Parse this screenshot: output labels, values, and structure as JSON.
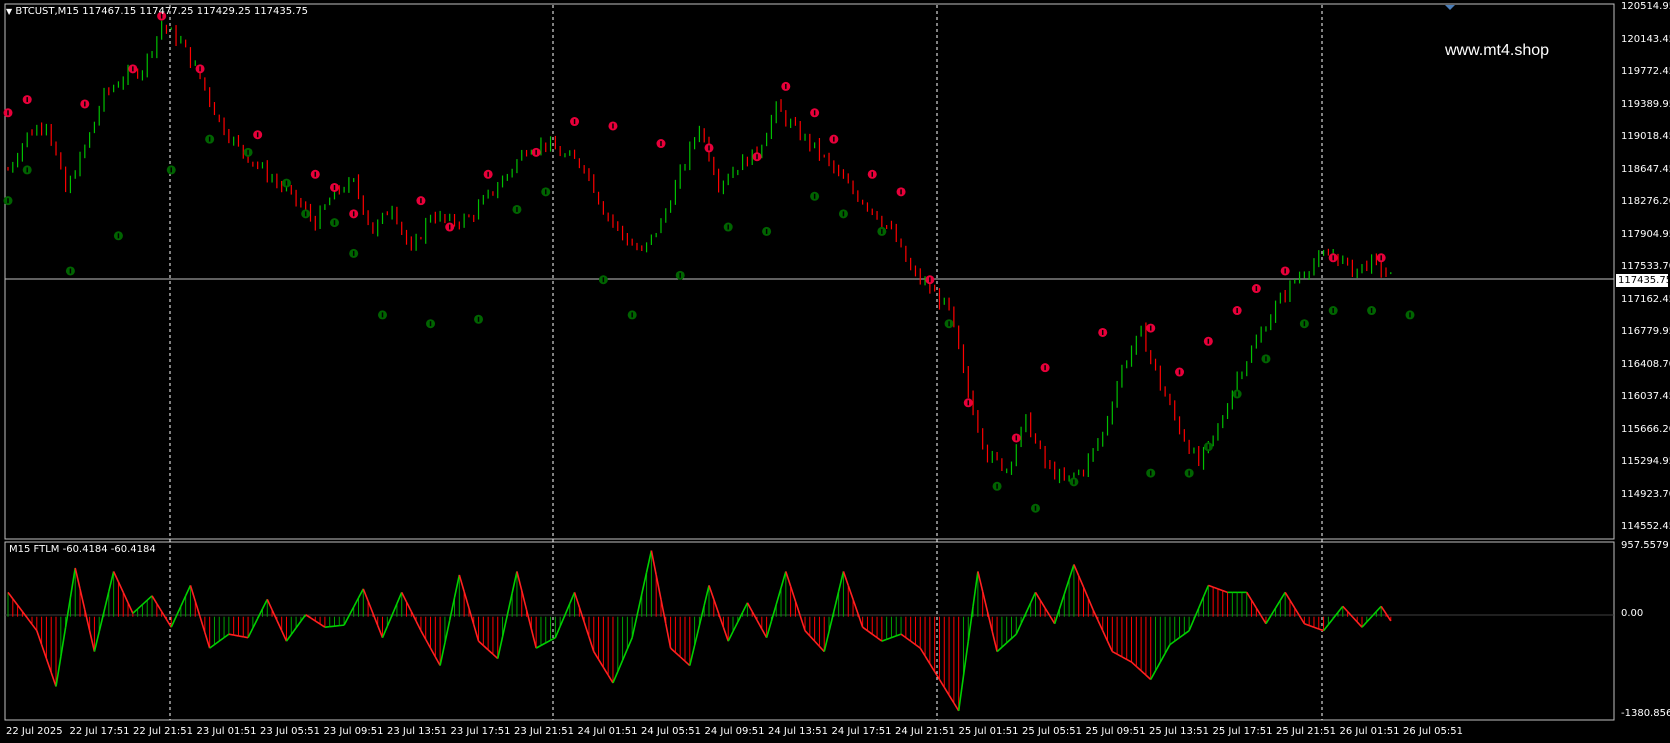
{
  "main_chart": {
    "menu_icon": "triangle-down-icon",
    "symbol_info": "BTCUST,M15  117467.15 117477.25 117429.25 117435.75",
    "watermark": "www.mt4.shop",
    "current_price": "117435.75",
    "price_scale": [
      "120514.95",
      "120143.45",
      "119772.45",
      "119389.95",
      "119018.45",
      "118647.45",
      "118276.20",
      "117904.95",
      "117533.70",
      "117162.45",
      "116779.95",
      "116408.70",
      "116037.45",
      "115666.20",
      "115294.95",
      "114923.70",
      "114552.45"
    ],
    "colors": {
      "bull": "#00c000",
      "bear": "#ff0000",
      "up_arrow": "#006400",
      "down_arrow": "#e8003a",
      "grid": "#ffffff"
    }
  },
  "indicator": {
    "title": "M15 FTLM -60.4184 -60.4184",
    "scale": [
      "957.5579",
      "0.00",
      "-1380.8564"
    ]
  },
  "time_axis": [
    "22 Jul 2025",
    "22 Jul 17:51",
    "22 Jul 21:51",
    "23 Jul 01:51",
    "23 Jul 05:51",
    "23 Jul 09:51",
    "23 Jul 13:51",
    "23 Jul 17:51",
    "23 Jul 21:51",
    "24 Jul 01:51",
    "24 Jul 05:51",
    "24 Jul 09:51",
    "24 Jul 13:51",
    "24 Jul 17:51",
    "24 Jul 21:51",
    "25 Jul 01:51",
    "25 Jul 05:51",
    "25 Jul 09:51",
    "25 Jul 13:51",
    "25 Jul 17:51",
    "25 Jul 21:51",
    "26 Jul 01:51",
    "26 Jul 05:51"
  ],
  "chart_data": {
    "type": "candlestick",
    "interval": "M15",
    "ylim": [
      114552.45,
      120514.95
    ],
    "close_path": [
      [
        0,
        118650
      ],
      [
        4,
        119050
      ],
      [
        8,
        119200
      ],
      [
        12,
        118400
      ],
      [
        16,
        118900
      ],
      [
        20,
        119500
      ],
      [
        24,
        119700
      ],
      [
        28,
        119800
      ],
      [
        32,
        120300
      ],
      [
        36,
        120100
      ],
      [
        40,
        119700
      ],
      [
        44,
        119200
      ],
      [
        48,
        118900
      ],
      [
        52,
        118700
      ],
      [
        56,
        118500
      ],
      [
        60,
        118300
      ],
      [
        64,
        118050
      ],
      [
        68,
        118400
      ],
      [
        72,
        118500
      ],
      [
        76,
        117950
      ],
      [
        80,
        118250
      ],
      [
        84,
        117700
      ],
      [
        88,
        118150
      ],
      [
        92,
        118050
      ],
      [
        96,
        118100
      ],
      [
        100,
        118350
      ],
      [
        104,
        118600
      ],
      [
        108,
        118900
      ],
      [
        112,
        118950
      ],
      [
        116,
        118800
      ],
      [
        120,
        118700
      ],
      [
        124,
        118200
      ],
      [
        128,
        117900
      ],
      [
        132,
        117700
      ],
      [
        136,
        118050
      ],
      [
        140,
        118600
      ],
      [
        144,
        119150
      ],
      [
        148,
        118500
      ],
      [
        152,
        118700
      ],
      [
        156,
        118850
      ],
      [
        160,
        119350
      ],
      [
        164,
        119100
      ],
      [
        168,
        118900
      ],
      [
        172,
        118650
      ],
      [
        176,
        118400
      ],
      [
        180,
        118200
      ],
      [
        184,
        117950
      ],
      [
        188,
        117500
      ],
      [
        192,
        117300
      ],
      [
        196,
        117050
      ],
      [
        200,
        116100
      ],
      [
        204,
        115400
      ],
      [
        208,
        115250
      ],
      [
        212,
        115800
      ],
      [
        216,
        115300
      ],
      [
        220,
        115100
      ],
      [
        224,
        115250
      ],
      [
        228,
        115650
      ],
      [
        232,
        116400
      ],
      [
        236,
        116800
      ],
      [
        240,
        116200
      ],
      [
        244,
        115700
      ],
      [
        248,
        115300
      ],
      [
        252,
        115700
      ],
      [
        256,
        116300
      ],
      [
        260,
        116700
      ],
      [
        264,
        117100
      ],
      [
        268,
        117400
      ],
      [
        272,
        117600
      ],
      [
        276,
        117700
      ],
      [
        280,
        117500
      ],
      [
        284,
        117600
      ],
      [
        288,
        117435
      ]
    ],
    "up_arrows": [
      [
        0,
        118300
      ],
      [
        4,
        118650
      ],
      [
        13,
        117500
      ],
      [
        23,
        117900
      ],
      [
        34,
        118650
      ],
      [
        42,
        119000
      ],
      [
        50,
        118850
      ],
      [
        58,
        118500
      ],
      [
        62,
        118150
      ],
      [
        68,
        118050
      ],
      [
        72,
        117700
      ],
      [
        78,
        117000
      ],
      [
        88,
        116900
      ],
      [
        98,
        116950
      ],
      [
        106,
        118200
      ],
      [
        112,
        118400
      ],
      [
        124,
        117400
      ],
      [
        130,
        117000
      ],
      [
        140,
        117450
      ],
      [
        150,
        118000
      ],
      [
        158,
        117950
      ],
      [
        168,
        118350
      ],
      [
        174,
        118150
      ],
      [
        182,
        117950
      ],
      [
        196,
        116900
      ],
      [
        206,
        115050
      ],
      [
        214,
        114800
      ],
      [
        222,
        115100
      ],
      [
        238,
        115200
      ],
      [
        246,
        115200
      ],
      [
        250,
        115500
      ],
      [
        256,
        116100
      ],
      [
        262,
        116500
      ],
      [
        270,
        116900
      ],
      [
        276,
        117050
      ],
      [
        284,
        117050
      ],
      [
        292,
        117000
      ]
    ],
    "down_arrows": [
      [
        0,
        119300
      ],
      [
        4,
        119450
      ],
      [
        16,
        119400
      ],
      [
        26,
        119800
      ],
      [
        32,
        120400
      ],
      [
        40,
        119800
      ],
      [
        52,
        119050
      ],
      [
        64,
        118600
      ],
      [
        68,
        118450
      ],
      [
        72,
        118150
      ],
      [
        86,
        118300
      ],
      [
        92,
        118000
      ],
      [
        100,
        118600
      ],
      [
        110,
        118850
      ],
      [
        118,
        119200
      ],
      [
        126,
        119150
      ],
      [
        136,
        118950
      ],
      [
        146,
        118900
      ],
      [
        156,
        118800
      ],
      [
        162,
        119600
      ],
      [
        168,
        119300
      ],
      [
        172,
        119000
      ],
      [
        180,
        118600
      ],
      [
        186,
        118400
      ],
      [
        192,
        117400
      ],
      [
        200,
        116000
      ],
      [
        210,
        115600
      ],
      [
        216,
        116400
      ],
      [
        228,
        116800
      ],
      [
        238,
        116850
      ],
      [
        244,
        116350
      ],
      [
        250,
        116700
      ],
      [
        256,
        117050
      ],
      [
        260,
        117300
      ],
      [
        266,
        117500
      ],
      [
        276,
        117650
      ],
      [
        286,
        117650
      ]
    ],
    "indicator_series": {
      "name": "FTLM",
      "ylim": [
        -1380.8564,
        957.5579
      ],
      "points": [
        [
          0,
          350
        ],
        [
          6,
          -200
        ],
        [
          10,
          -1000
        ],
        [
          14,
          700
        ],
        [
          18,
          -500
        ],
        [
          22,
          650
        ],
        [
          26,
          50
        ],
        [
          30,
          300
        ],
        [
          34,
          -150
        ],
        [
          38,
          450
        ],
        [
          42,
          -450
        ],
        [
          46,
          -250
        ],
        [
          50,
          -300
        ],
        [
          54,
          250
        ],
        [
          58,
          -350
        ],
        [
          62,
          30
        ],
        [
          66,
          -150
        ],
        [
          70,
          -120
        ],
        [
          74,
          400
        ],
        [
          78,
          -300
        ],
        [
          82,
          350
        ],
        [
          86,
          -200
        ],
        [
          90,
          -700
        ],
        [
          94,
          600
        ],
        [
          98,
          -350
        ],
        [
          102,
          -600
        ],
        [
          106,
          650
        ],
        [
          110,
          -450
        ],
        [
          114,
          -300
        ],
        [
          118,
          350
        ],
        [
          122,
          -500
        ],
        [
          126,
          -950
        ],
        [
          130,
          -300
        ],
        [
          134,
          950
        ],
        [
          138,
          -450
        ],
        [
          142,
          -700
        ],
        [
          146,
          450
        ],
        [
          150,
          -350
        ],
        [
          154,
          200
        ],
        [
          158,
          -300
        ],
        [
          162,
          650
        ],
        [
          166,
          -200
        ],
        [
          170,
          -500
        ],
        [
          174,
          650
        ],
        [
          178,
          -150
        ],
        [
          182,
          -350
        ],
        [
          186,
          -250
        ],
        [
          190,
          -450
        ],
        [
          194,
          -900
        ],
        [
          198,
          -1350
        ],
        [
          202,
          650
        ],
        [
          206,
          -500
        ],
        [
          210,
          -250
        ],
        [
          214,
          350
        ],
        [
          218,
          -100
        ],
        [
          222,
          750
        ],
        [
          226,
          100
        ],
        [
          230,
          -500
        ],
        [
          234,
          -650
        ],
        [
          238,
          -900
        ],
        [
          242,
          -400
        ],
        [
          246,
          -200
        ],
        [
          250,
          450
        ],
        [
          254,
          350
        ],
        [
          258,
          350
        ],
        [
          262,
          -100
        ],
        [
          266,
          350
        ],
        [
          270,
          -100
        ],
        [
          274,
          -200
        ],
        [
          278,
          150
        ],
        [
          282,
          -150
        ],
        [
          286,
          150
        ],
        [
          288,
          -60
        ]
      ]
    }
  }
}
